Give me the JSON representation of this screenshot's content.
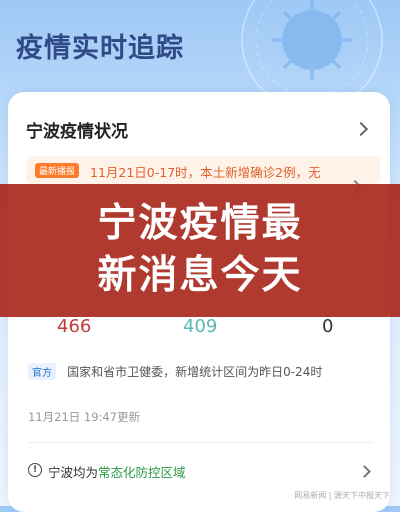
{
  "header": {
    "title": "疫情实时追踪"
  },
  "card": {
    "title": "宁波疫情状况",
    "news": {
      "tag": "最新播报",
      "text": "11月21日0-17时，本土新增确诊2例，无"
    },
    "stats": [
      "466",
      "409",
      "0"
    ],
    "official": {
      "tag": "官方",
      "text": "国家和省市卫健委，新增统计区间为昨日0-24时"
    },
    "updated": "11月21日 19:47更新",
    "region": {
      "prefix": "宁波均为",
      "highlight": "常态化防控区域"
    }
  },
  "banner": {
    "line1": "宁波疫情最",
    "line2": "新消息今天"
  },
  "watermark": "网易新闻 | 源天下中报天下",
  "colors": {
    "banner": "#aa2a20",
    "accent_red": "#c23a36",
    "accent_teal": "#5bb8b3",
    "news_orange": "#ff7a2a",
    "region_green": "#2a9c44"
  }
}
